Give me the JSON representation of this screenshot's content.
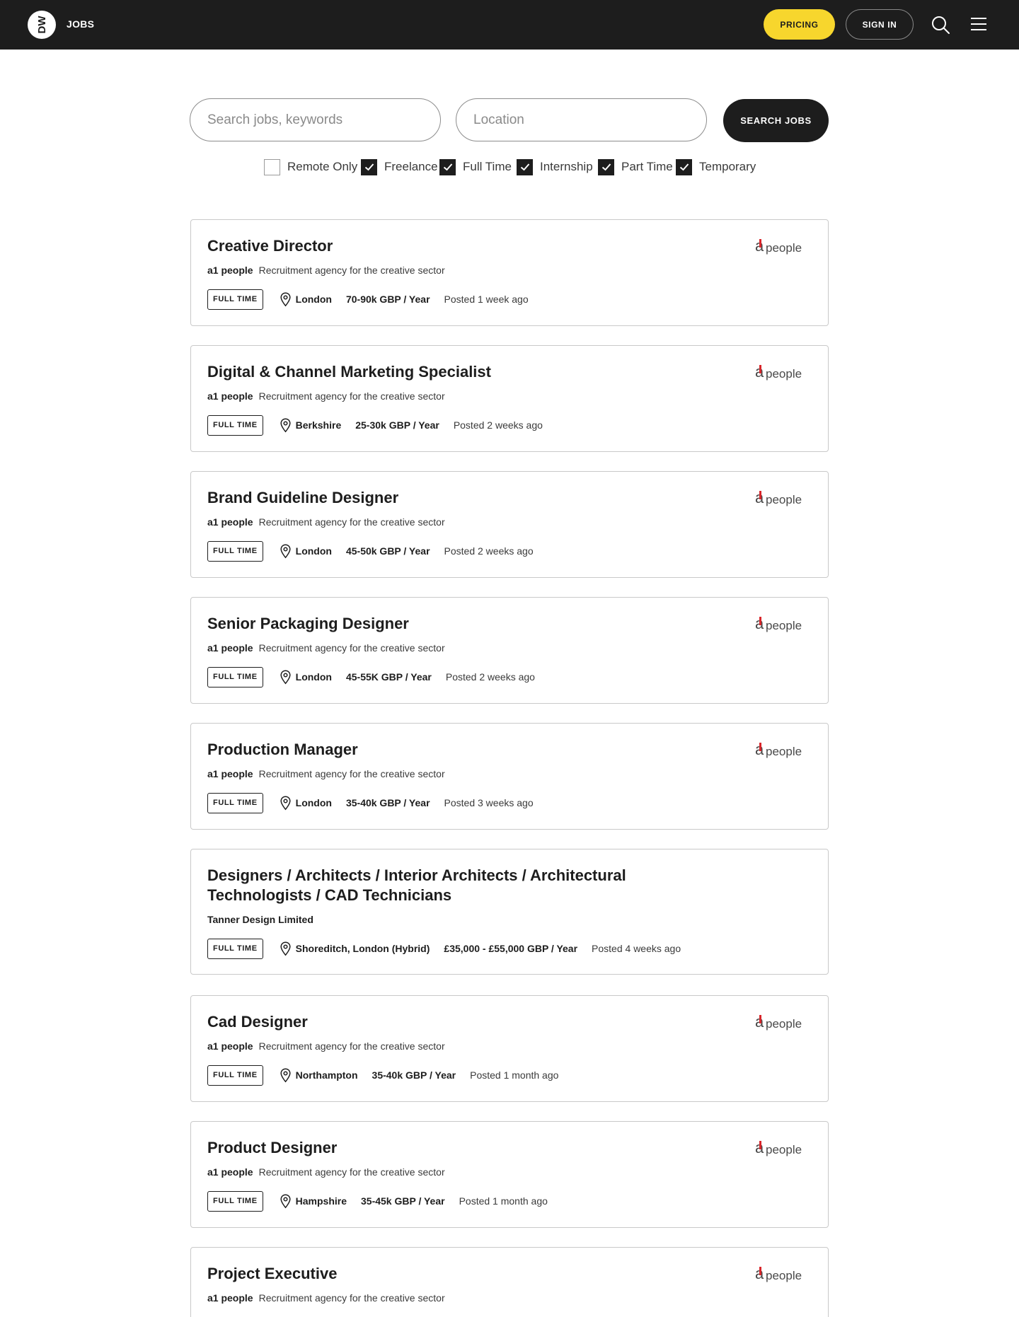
{
  "header": {
    "logo_text": "DW",
    "section_label": "JOBS",
    "pricing_label": "PRICING",
    "signin_label": "SIGN IN"
  },
  "search": {
    "keywords_placeholder": "Search jobs, keywords",
    "location_placeholder": "Location",
    "button_label": "SEARCH JOBS"
  },
  "filters": [
    {
      "label": "Remote Only",
      "checked": false
    },
    {
      "label": "Freelance",
      "checked": true
    },
    {
      "label": "Full Time",
      "checked": true
    },
    {
      "label": "Internship",
      "checked": true
    },
    {
      "label": "Part Time",
      "checked": true
    },
    {
      "label": "Temporary",
      "checked": true
    }
  ],
  "colors": {
    "header_bg": "#1d1d1d",
    "accent_yellow": "#f7d62d",
    "logo_red": "#d8262b"
  },
  "jobs": [
    {
      "title": "Creative Director",
      "company": "a1 people",
      "description": "Recruitment agency for the creative sector",
      "type": "FULL TIME",
      "location": "London",
      "salary": "70-90k GBP / Year",
      "posted": "Posted 1 week ago",
      "logo": "a1people",
      "logo_text": "people"
    },
    {
      "title": "Digital & Channel Marketing Specialist",
      "company": "a1 people",
      "description": "Recruitment agency for the creative sector",
      "type": "FULL TIME",
      "location": "Berkshire",
      "salary": "25-30k GBP / Year",
      "posted": "Posted 2 weeks ago",
      "logo": "a1people",
      "logo_text": "people"
    },
    {
      "title": "Brand Guideline Designer",
      "company": "a1 people",
      "description": "Recruitment agency for the creative sector",
      "type": "FULL TIME",
      "location": "London",
      "salary": "45-50k GBP / Year",
      "posted": "Posted 2 weeks ago",
      "logo": "a1people",
      "logo_text": "people"
    },
    {
      "title": "Senior Packaging Designer",
      "company": "a1 people",
      "description": "Recruitment agency for the creative sector",
      "type": "FULL TIME",
      "location": "London",
      "salary": "45-55K GBP / Year",
      "posted": "Posted 2 weeks ago",
      "logo": "a1people",
      "logo_text": "people"
    },
    {
      "title": "Production Manager",
      "company": "a1 people",
      "description": "Recruitment agency for the creative sector",
      "type": "FULL TIME",
      "location": "London",
      "salary": "35-40k GBP / Year",
      "posted": "Posted 3 weeks ago",
      "logo": "a1people",
      "logo_text": "people"
    },
    {
      "title": "Designers / Architects / Interior Architects / Architectural Technologists / CAD Technicians",
      "company": "Tanner Design Limited",
      "description": "",
      "type": "FULL TIME",
      "location": "Shoreditch, London (Hybrid)",
      "salary": "£35,000 - £55,000 GBP / Year",
      "posted": "Posted 4 weeks ago",
      "logo": "",
      "logo_text": ""
    },
    {
      "title": "Cad Designer",
      "company": "a1 people",
      "description": "Recruitment agency for the creative sector",
      "type": "FULL TIME",
      "location": "Northampton",
      "salary": "35-40k GBP / Year",
      "posted": "Posted 1 month ago",
      "logo": "a1people",
      "logo_text": "people"
    },
    {
      "title": "Product Designer",
      "company": "a1 people",
      "description": "Recruitment agency for the creative sector",
      "type": "FULL TIME",
      "location": "Hampshire",
      "salary": "35-45k GBP / Year",
      "posted": "Posted 1 month ago",
      "logo": "a1people",
      "logo_text": "people"
    },
    {
      "title": "Project Executive",
      "company": "a1 people",
      "description": "Recruitment agency for the creative sector",
      "type": "",
      "location": "",
      "salary": "",
      "posted": "",
      "logo": "a1people",
      "logo_text": "people"
    }
  ]
}
